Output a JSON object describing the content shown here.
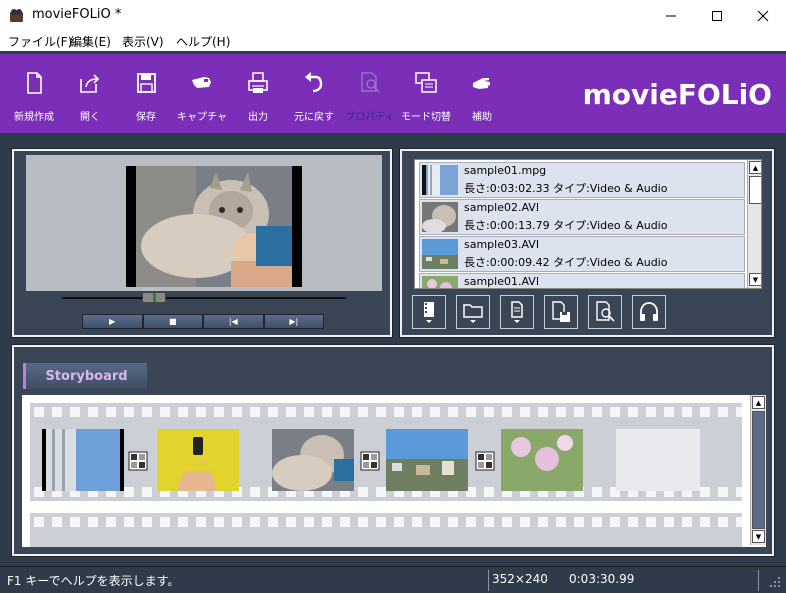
{
  "window": {
    "title": "movieFOLiO *",
    "icon": "film-reel-icon"
  },
  "menu": [
    {
      "label": "ファイル(F)"
    },
    {
      "label": "編集(E)"
    },
    {
      "label": "表示(V)"
    },
    {
      "label": "ヘルプ(H)"
    }
  ],
  "toolbar": {
    "buttons": [
      {
        "label": "新規作成",
        "icon": "new-document-icon"
      },
      {
        "label": "開く",
        "icon": "open-icon"
      },
      {
        "label": "保存",
        "icon": "save-icon"
      },
      {
        "label": "キャプチャ",
        "icon": "capture-camera-icon"
      },
      {
        "label": "出力",
        "icon": "print-output-icon"
      },
      {
        "label": "元に戻す",
        "icon": "undo-icon"
      },
      {
        "label": "プロパティ",
        "icon": "properties-icon",
        "disabled": true
      },
      {
        "label": "モード切替",
        "icon": "mode-switch-icon"
      },
      {
        "label": "補助",
        "icon": "assist-hand-icon"
      }
    ],
    "brand": "movieFOLiO",
    "accent_color": "#7b2fb8"
  },
  "player": {
    "controls": [
      "▶",
      "■",
      "|◀",
      "▶|"
    ]
  },
  "media_list": {
    "items": [
      {
        "name": "sample01.mpg",
        "info": "長さ:0:03:02.33  タイプ:Video & Audio"
      },
      {
        "name": "sample02.AVI",
        "info": "長さ:0:00:13.79  タイプ:Video & Audio"
      },
      {
        "name": "sample03.AVI",
        "info": "長さ:0:00:09.42  タイプ:Video & Audio"
      },
      {
        "name": "sample01.AVI",
        "info": ""
      }
    ],
    "tools": [
      "video-menu-icon",
      "folder-menu-icon",
      "document-menu-icon",
      "save-list-icon",
      "preview-icon",
      "audio-headphones-icon"
    ]
  },
  "storyboard": {
    "tab_label": "Storyboard"
  },
  "status": {
    "message": "F1 キーでヘルプを表示します。",
    "resolution": "352×240",
    "duration": "0:03:30.99"
  }
}
